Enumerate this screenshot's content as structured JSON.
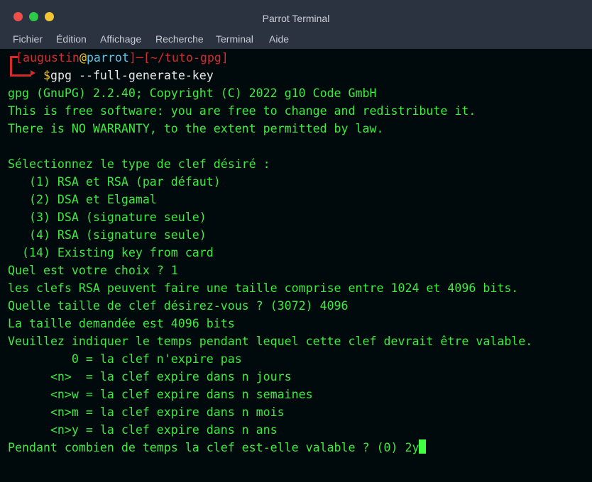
{
  "window": {
    "title": "Parrot Terminal"
  },
  "menu": {
    "items": [
      "Fichier",
      "Édition",
      "Affichage",
      "Recherche",
      "Terminal",
      "Aide"
    ]
  },
  "prompt": {
    "open_bracket": "[",
    "user": "augustin",
    "at": "@",
    "host": "parrot",
    "close_bracket": "]",
    "sep": "─",
    "path_open": "[",
    "path": "~/tuto-gpg",
    "path_close": "]",
    "dollar": "$",
    "command": "gpg --full-generate-key"
  },
  "output": {
    "lines": [
      "gpg (GnuPG) 2.2.40; Copyright (C) 2022 g10 Code GmbH",
      "This is free software: you are free to change and redistribute it.",
      "There is NO WARRANTY, to the extent permitted by law.",
      "",
      "Sélectionnez le type de clef désiré :",
      "   (1) RSA et RSA (par défaut)",
      "   (2) DSA et Elgamal",
      "   (3) DSA (signature seule)",
      "   (4) RSA (signature seule)",
      "  (14) Existing key from card",
      "Quel est votre choix ? 1",
      "les clefs RSA peuvent faire une taille comprise entre 1024 et 4096 bits.",
      "Quelle taille de clef désirez-vous ? (3072) 4096",
      "La taille demandée est 4096 bits",
      "Veuillez indiquer le temps pendant lequel cette clef devrait être valable.",
      "         0 = la clef n'expire pas",
      "      <n>  = la clef expire dans n jours",
      "      <n>w = la clef expire dans n semaines",
      "      <n>m = la clef expire dans n mois",
      "      <n>y = la clef expire dans n ans"
    ],
    "input_line": "Pendant combien de temps la clef est-elle valable ? (0) 2y"
  }
}
